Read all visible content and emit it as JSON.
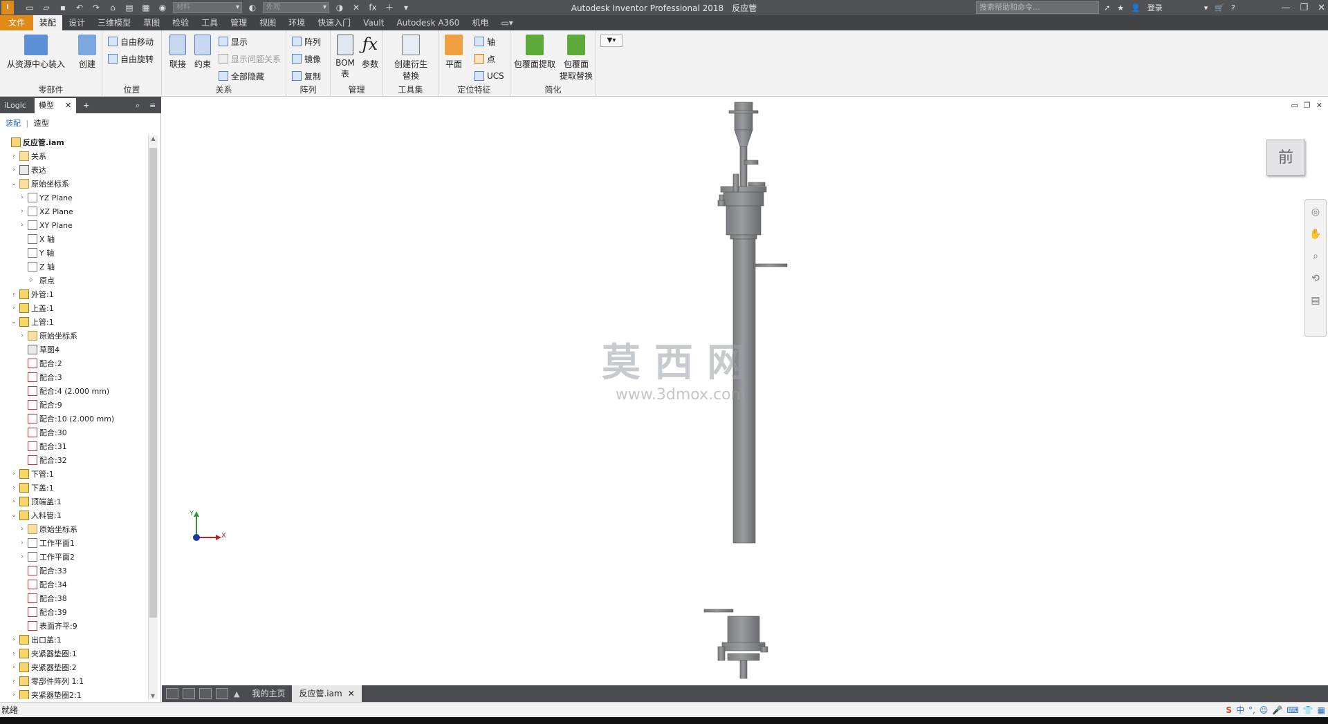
{
  "titlebar": {
    "app_icon": "I PRO",
    "app_title": "Autodesk Inventor Professional 2018",
    "doc_title": "反应管",
    "search_placeholder": "搜索帮助和命令...",
    "signin": "登录",
    "qat_combo1": "材料",
    "qat_combo2": "外观",
    "qat_fx": "fx"
  },
  "menu": {
    "tabs": [
      "文件",
      "装配",
      "设计",
      "三维模型",
      "草图",
      "检验",
      "工具",
      "管理",
      "视图",
      "环境",
      "快速入门",
      "Vault",
      "Autodesk A360",
      "机电"
    ],
    "active": "装配"
  },
  "ribbon": {
    "component": {
      "place": "从资源中心装入",
      "create": "创建",
      "label": "零部件"
    },
    "position": {
      "free_move": "自由移动",
      "free_rotate": "自由旋转",
      "label": "位置"
    },
    "relationships": {
      "joint": "联接",
      "constrain": "约束",
      "show": "显示",
      "show_sick": "显示问题关系",
      "hide_all": "全部隐藏",
      "label": "关系"
    },
    "pattern": {
      "pattern": "阵列",
      "mirror": "镜像",
      "copy": "复制",
      "label": "阵列"
    },
    "manage": {
      "bom": "BOM",
      "bom2": "表",
      "params": "参数",
      "label": "管理"
    },
    "productivity": {
      "create_sub": "创建衍生",
      "create_sub2": "替换",
      "label": "工具集"
    },
    "work_features": {
      "plane": "平面",
      "axis": "轴",
      "point": "点",
      "ucs": "UCS",
      "label": "定位特征"
    },
    "simplification": {
      "shrinkwrap": "包覆面提取",
      "shrinkwrap_sub1": "包覆面",
      "shrinkwrap_sub2": "提取替换",
      "label": "简化"
    }
  },
  "browser": {
    "tabs": [
      "iLogic",
      "模型"
    ],
    "active_tab": "模型",
    "plus": "+",
    "sub_left": "装配",
    "sub_sep": "|",
    "sub_right": "造型",
    "tree": [
      {
        "label": "反应管.iam",
        "level": 0,
        "icon": "asm",
        "exp": ""
      },
      {
        "label": "关系",
        "level": 1,
        "icon": "fold",
        "exp": "›"
      },
      {
        "label": "表达",
        "level": 1,
        "icon": "sketch",
        "exp": "›"
      },
      {
        "label": "原始坐标系",
        "level": 1,
        "icon": "fold",
        "exp": "⌄"
      },
      {
        "label": "YZ Plane",
        "level": 2,
        "icon": "plane",
        "exp": "›"
      },
      {
        "label": "XZ Plane",
        "level": 2,
        "icon": "plane",
        "exp": "›"
      },
      {
        "label": "XY Plane",
        "level": 2,
        "icon": "plane",
        "exp": "›"
      },
      {
        "label": "X 轴",
        "level": 2,
        "icon": "plane",
        "exp": ""
      },
      {
        "label": "Y 轴",
        "level": 2,
        "icon": "plane",
        "exp": ""
      },
      {
        "label": "Z 轴",
        "level": 2,
        "icon": "plane",
        "exp": ""
      },
      {
        "label": "原点",
        "level": 2,
        "icon": "pt",
        "exp": ""
      },
      {
        "label": "外管:1",
        "level": 1,
        "icon": "part",
        "exp": "›"
      },
      {
        "label": "上盖:1",
        "level": 1,
        "icon": "part",
        "exp": "›"
      },
      {
        "label": "上管:1",
        "level": 1,
        "icon": "part",
        "exp": "⌄"
      },
      {
        "label": "原始坐标系",
        "level": 2,
        "icon": "fold",
        "exp": "›"
      },
      {
        "label": "草图4",
        "level": 2,
        "icon": "sketch",
        "exp": ""
      },
      {
        "label": "配合:2",
        "level": 2,
        "icon": "mate",
        "exp": ""
      },
      {
        "label": "配合:3",
        "level": 2,
        "icon": "mate",
        "exp": ""
      },
      {
        "label": "配合:4 (2.000 mm)",
        "level": 2,
        "icon": "mate",
        "exp": ""
      },
      {
        "label": "配合:9",
        "level": 2,
        "icon": "mate",
        "exp": ""
      },
      {
        "label": "配合:10 (2.000 mm)",
        "level": 2,
        "icon": "mate",
        "exp": ""
      },
      {
        "label": "配合:30",
        "level": 2,
        "icon": "mate",
        "exp": ""
      },
      {
        "label": "配合:31",
        "level": 2,
        "icon": "mate",
        "exp": ""
      },
      {
        "label": "配合:32",
        "level": 2,
        "icon": "mate",
        "exp": ""
      },
      {
        "label": "下管:1",
        "level": 1,
        "icon": "part",
        "exp": "›"
      },
      {
        "label": "下盖:1",
        "level": 1,
        "icon": "part",
        "exp": "›"
      },
      {
        "label": "顶端盖:1",
        "level": 1,
        "icon": "part",
        "exp": "›"
      },
      {
        "label": "入料管:1",
        "level": 1,
        "icon": "part",
        "exp": "⌄"
      },
      {
        "label": "原始坐标系",
        "level": 2,
        "icon": "fold",
        "exp": "›"
      },
      {
        "label": "工作平面1",
        "level": 2,
        "icon": "plane",
        "exp": "›"
      },
      {
        "label": "工作平面2",
        "level": 2,
        "icon": "plane",
        "exp": "›"
      },
      {
        "label": "配合:33",
        "level": 2,
        "icon": "mate",
        "exp": ""
      },
      {
        "label": "配合:34",
        "level": 2,
        "icon": "mate",
        "exp": ""
      },
      {
        "label": "配合:38",
        "level": 2,
        "icon": "mate",
        "exp": ""
      },
      {
        "label": "配合:39",
        "level": 2,
        "icon": "mate",
        "exp": ""
      },
      {
        "label": "表面齐平:9",
        "level": 2,
        "icon": "mate",
        "exp": ""
      },
      {
        "label": "出口盖:1",
        "level": 1,
        "icon": "part",
        "exp": "›"
      },
      {
        "label": "夹紧器垫圈:1",
        "level": 1,
        "icon": "part",
        "exp": "›"
      },
      {
        "label": "夹紧器垫圈:2",
        "level": 1,
        "icon": "part",
        "exp": "›"
      },
      {
        "label": "零部件阵列 1:1",
        "level": 1,
        "icon": "asm",
        "exp": "›"
      },
      {
        "label": "夹紧器垫圈2:1",
        "level": 1,
        "icon": "part",
        "exp": "›"
      }
    ]
  },
  "viewport": {
    "viewcube_label": "前",
    "watermark_cn": "莫西网",
    "watermark_url": "www.3dmox.com",
    "triad_y": "Y",
    "triad_x": "X"
  },
  "docbar": {
    "tabs": [
      "我的主页",
      "反应管.iam"
    ],
    "active": "反应管.iam"
  },
  "status": {
    "text": "就绪"
  }
}
